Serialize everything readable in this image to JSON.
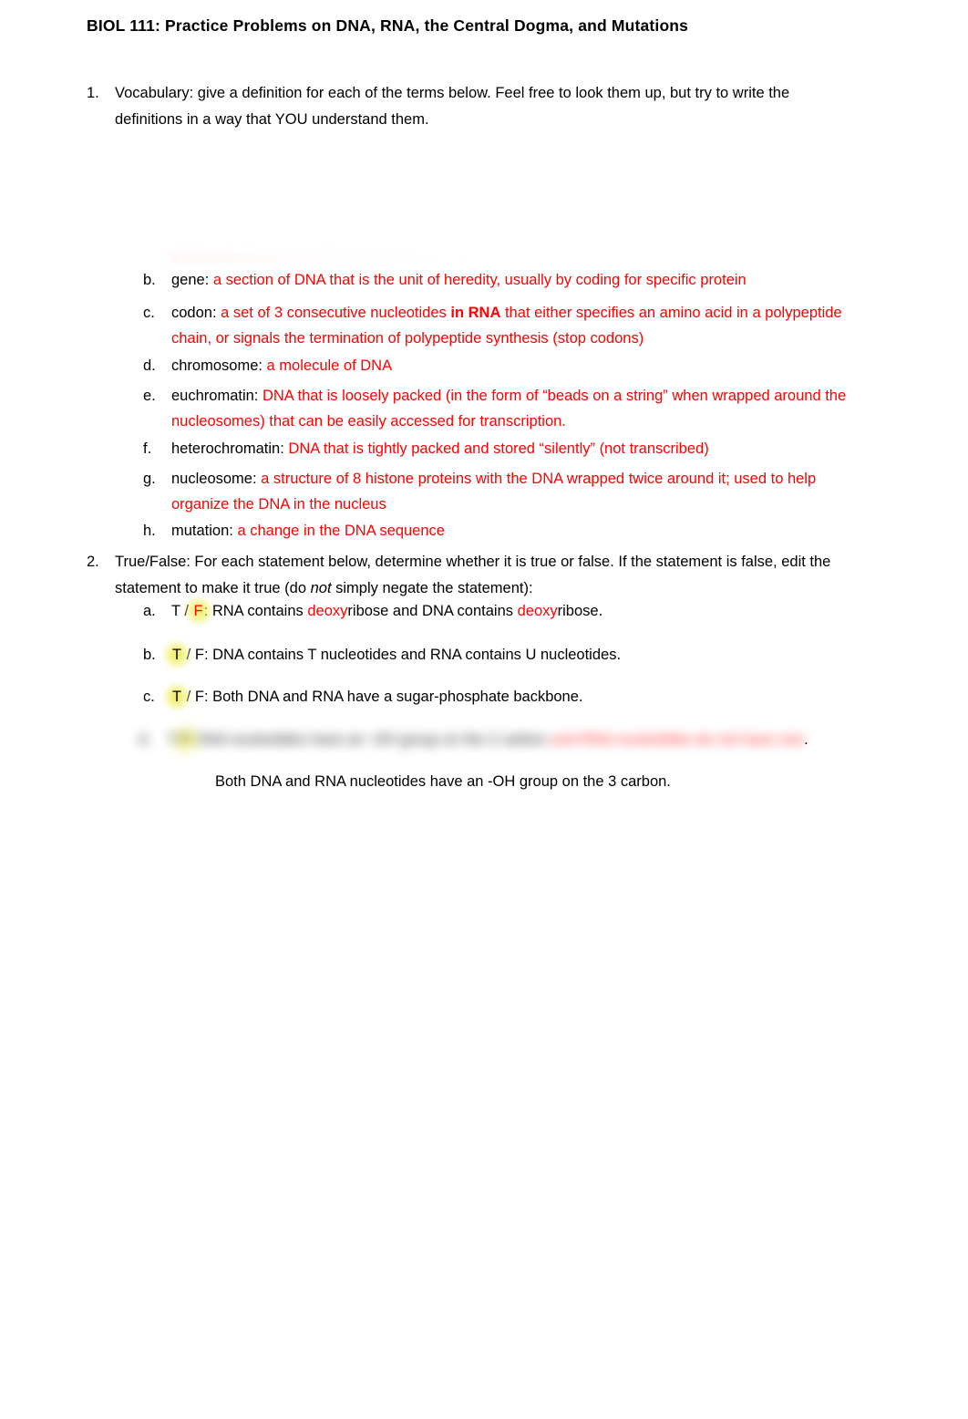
{
  "document": {
    "title": "BIOL 111: Practice Problems on DNA, RNA, the Central Dogma, and Mutations",
    "page_background": "#ffffff",
    "answer_color": "#ff0000",
    "highlight_color": "#ecE83c"
  },
  "questions": [
    {
      "marker": "1.",
      "prompt_line1": "Vocabulary: give a definition for each of the terms below.  Feel free to look them up, but try to write the",
      "prompt_line2": "definitions in a way that YOU understand them.",
      "items": [
        {
          "marker": "b.",
          "term": "gene: ",
          "answer": "a section of DNA that is the unit of heredity, usually by coding for specific protein"
        },
        {
          "marker": "c.",
          "term": "codon: ",
          "answer_pre": "a set of 3 consecutive nucleotides ",
          "answer_bold": "in RNA",
          "answer_post": " that either specifies an amino acid in a polypeptide",
          "answer_line2": "chain, or signals the termination of polypeptide synthesis (stop codons)"
        },
        {
          "marker": "d.",
          "term": "chromosome: ",
          "answer": "a molecule of DNA"
        },
        {
          "marker": "e.",
          "term": "euchromatin: ",
          "answer": "DNA that is loosely packed (in the form of “beads on a string” when wrapped around the",
          "answer_line2": "nucleosomes) that can be easily accessed for transcription."
        },
        {
          "marker": "f.",
          "term": "heterochromatin: ",
          "answer": "DNA that is tightly packed and stored “silently” (not transcribed)"
        },
        {
          "marker": "g.",
          "term": "nucleosome: ",
          "answer": "a structure of 8 histone proteins with the DNA wrapped twice around it; used to help",
          "answer_line2": "organize the DNA in the nucleus"
        },
        {
          "marker": "h.",
          "term": "mutation: ",
          "answer": "a change in the DNA sequence"
        }
      ]
    },
    {
      "marker": "2.",
      "prompt_line1_a": "True/False: For each statement below, determine whether it is true or false.  If the statement is false, edit the",
      "prompt_line2_a": "statement to make it true (do ",
      "prompt_line2_italic": "not",
      "prompt_line2_b": " simply negate the statement):",
      "items": [
        {
          "marker": "a.",
          "choice_true": "T",
          "separator": " / ",
          "choice_false": "F",
          "selected": "F",
          "colon": ":  ",
          "text_pre": "RNA contains ",
          "text_red1": "deoxy",
          "text_mid": "ribose and DNA contains ",
          "text_red2": "deoxy",
          "text_post": "ribose."
        },
        {
          "marker": "b.",
          "choice_true": "T",
          "separator": " / ",
          "choice_false": "F",
          "selected": "T",
          "colon": ":  ",
          "text": "DNA contains T nucleotides and RNA contains U nucleotides."
        },
        {
          "marker": "c.",
          "choice_true": "T",
          "separator": " / ",
          "choice_false": "F",
          "selected": "T",
          "colon": ":  ",
          "text": "Both DNA and RNA have a sugar-phosphate backbone."
        },
        {
          "marker": "d.",
          "choice_true": "T",
          "separator": " / ",
          "choice_false": "F",
          "selected": "F",
          "colon": ":  ",
          "redacted": true,
          "obscured_black": "DNA nucleotides have an -OH group on the 2 carbon",
          "obscured_red": "and RNA nucleotides do not have one",
          "trailing": "."
        }
      ],
      "closing_note": "Both DNA and RNA nucleotides have an -OH group on the 3 carbon."
    }
  ]
}
